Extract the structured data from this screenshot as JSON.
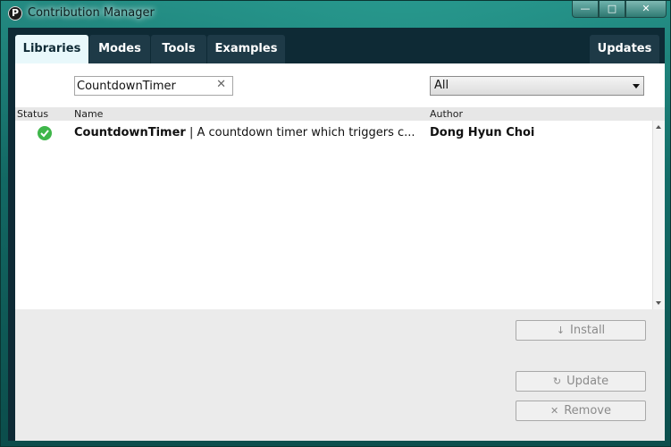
{
  "window": {
    "title": "Contribution Manager",
    "icon": "processing-icon"
  },
  "controls": {
    "minimize": "—",
    "maximize": "□",
    "close": "✕"
  },
  "tabs": [
    {
      "label": "Libraries",
      "active": true
    },
    {
      "label": "Modes",
      "active": false
    },
    {
      "label": "Tools",
      "active": false
    },
    {
      "label": "Examples",
      "active": false
    }
  ],
  "updates_tab": {
    "label": "Updates"
  },
  "search": {
    "value": "CountdownTimer",
    "clear_icon": "✕"
  },
  "category": {
    "selected": "All"
  },
  "table": {
    "headers": {
      "status": "Status",
      "name": "Name",
      "author": "Author"
    },
    "rows": [
      {
        "status": "installed",
        "name": "CountdownTimer",
        "description": "| A countdown timer which triggers c...",
        "author": "Dong Hyun Choi"
      }
    ]
  },
  "actions": {
    "install": {
      "label": "Install",
      "icon": "↓"
    },
    "update": {
      "label": "Update",
      "icon": "↻"
    },
    "remove": {
      "label": "Remove",
      "icon": "✕"
    }
  },
  "colors": {
    "client_bg": "#0e2a35",
    "active_tab_bg": "#e8f8fb",
    "inactive_tab_bg": "#1e3a47",
    "status_installed": "#3fb64a"
  }
}
